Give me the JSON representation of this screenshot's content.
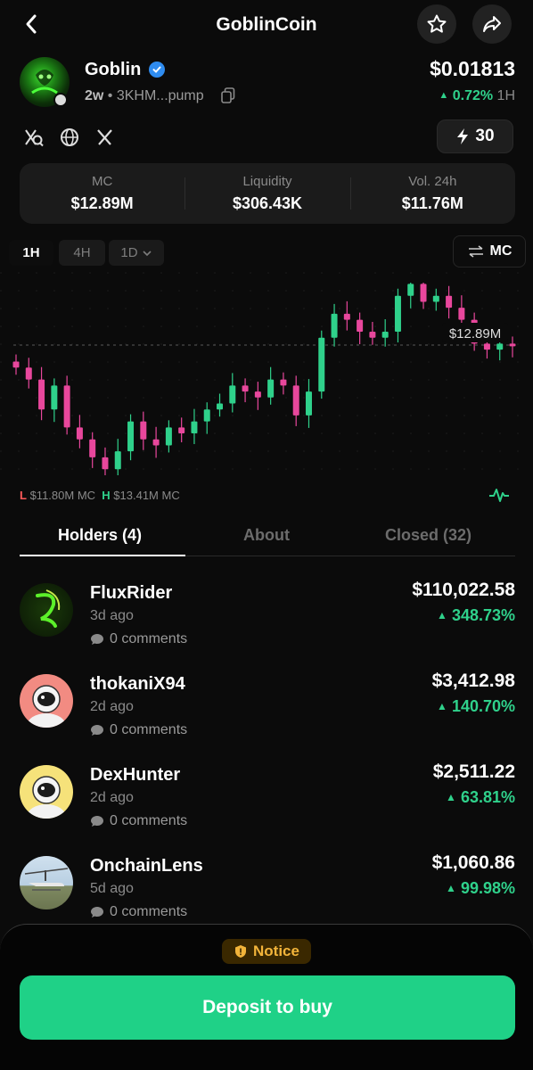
{
  "header": {
    "title": "GoblinCoin"
  },
  "token": {
    "name": "Goblin",
    "age": "2w",
    "address": "3KHM...pump",
    "price": "$0.01813",
    "change": "0.72%",
    "change_tf": "1H"
  },
  "boost": {
    "label": "30"
  },
  "stats": [
    {
      "label": "MC",
      "value": "$12.89M"
    },
    {
      "label": "Liquidity",
      "value": "$306.43K"
    },
    {
      "label": "Vol. 24h",
      "value": "$11.76M"
    }
  ],
  "timeframes": [
    "1H",
    "4H",
    "1D"
  ],
  "active_timeframe": "1H",
  "chart_toggle": "MC",
  "chart": {
    "current_label": "$12.89M",
    "low_prefix": "L",
    "low_value": "$11.80M MC",
    "high_prefix": "H",
    "high_value": "$13.41M MC"
  },
  "chart_data": {
    "type": "candlestick",
    "unit": "MC ($M)",
    "current": 12.89,
    "low": 11.8,
    "high": 13.41,
    "candles_approx_close": [
      12.7,
      12.6,
      12.35,
      12.55,
      12.2,
      12.1,
      11.95,
      11.85,
      12.0,
      12.25,
      12.1,
      12.05,
      12.2,
      12.15,
      12.25,
      12.35,
      12.4,
      12.55,
      12.5,
      12.45,
      12.6,
      12.55,
      12.3,
      12.5,
      12.95,
      13.15,
      13.1,
      13.0,
      12.95,
      13.0,
      13.3,
      13.4,
      13.25,
      13.3,
      13.2,
      13.1,
      12.9,
      12.85,
      12.9,
      12.89
    ]
  },
  "tabs": [
    {
      "label": "Holders (4)"
    },
    {
      "label": "About"
    },
    {
      "label": "Closed (32)"
    }
  ],
  "holders": [
    {
      "name": "FluxRider",
      "ago": "3d ago",
      "comments": "0 comments",
      "value": "$110,022.58",
      "pct": "348.73%"
    },
    {
      "name": "thokaniX94",
      "ago": "2d ago",
      "comments": "0 comments",
      "value": "$3,412.98",
      "pct": "140.70%"
    },
    {
      "name": "DexHunter",
      "ago": "2d ago",
      "comments": "0 comments",
      "value": "$2,511.22",
      "pct": "63.81%"
    },
    {
      "name": "OnchainLens",
      "ago": "5d ago",
      "comments": "0 comments",
      "value": "$1,060.86",
      "pct": "99.98%"
    }
  ],
  "notice": {
    "label": "Notice"
  },
  "cta": {
    "label": "Deposit to buy"
  },
  "colors": {
    "up": "#2fd18b",
    "down": "#e8479c",
    "cta": "#1fd187",
    "notice": "#f2b43a"
  }
}
